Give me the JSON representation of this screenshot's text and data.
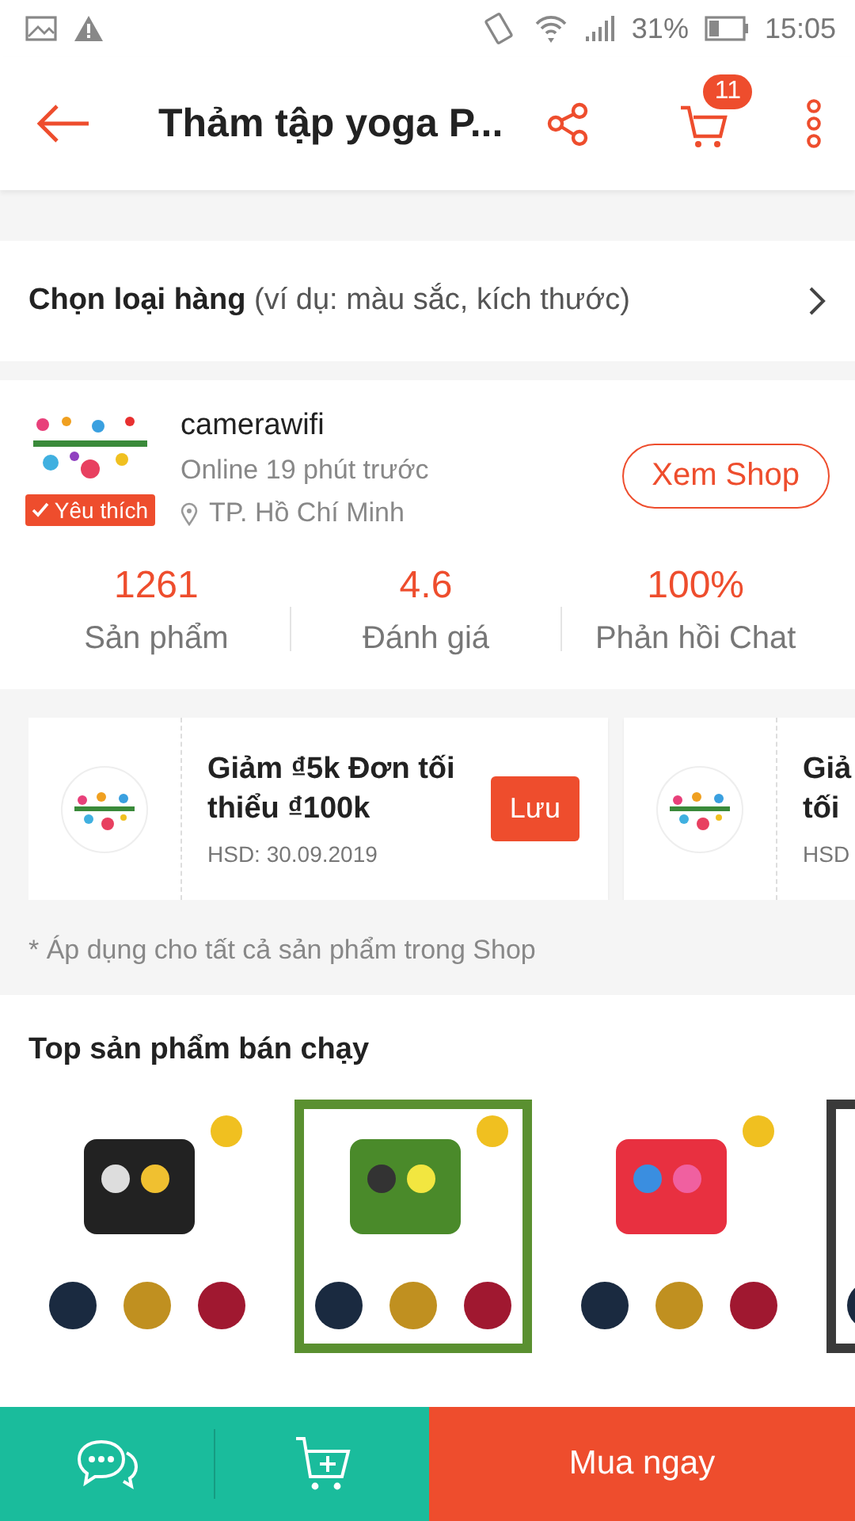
{
  "status_bar": {
    "battery": "31%",
    "time": "15:05"
  },
  "header": {
    "title": "Thảm tập yoga P...",
    "cart_count": "11"
  },
  "variant": {
    "label": "Chọn loại hàng",
    "hint": "(ví dụ: màu sắc, kích thước)"
  },
  "shop": {
    "name": "camerawifi",
    "badge": "Yêu thích",
    "online": "Online 19 phút trước",
    "location": "TP. Hồ Chí Minh",
    "button": "Xem Shop",
    "stats": [
      {
        "value": "1261",
        "label": "Sản phẩm"
      },
      {
        "value": "4.6",
        "label": "Đánh giá"
      },
      {
        "value": "100%",
        "label": "Phản hồi Chat"
      }
    ]
  },
  "vouchers": [
    {
      "title": "Giảm ₫5k Đơn tối\nthiểu ₫100k",
      "expiry": "HSD: 30.09.2019",
      "button": "Lưu"
    },
    {
      "title": "Giả\ntối",
      "expiry": "HSD"
    }
  ],
  "voucher_note": "* Áp dụng cho tất cả sản phẩm trong Shop",
  "top_products": {
    "title": "Top sản phẩm bán chạy"
  },
  "bottom_bar": {
    "buy_button": "Mua ngay"
  }
}
